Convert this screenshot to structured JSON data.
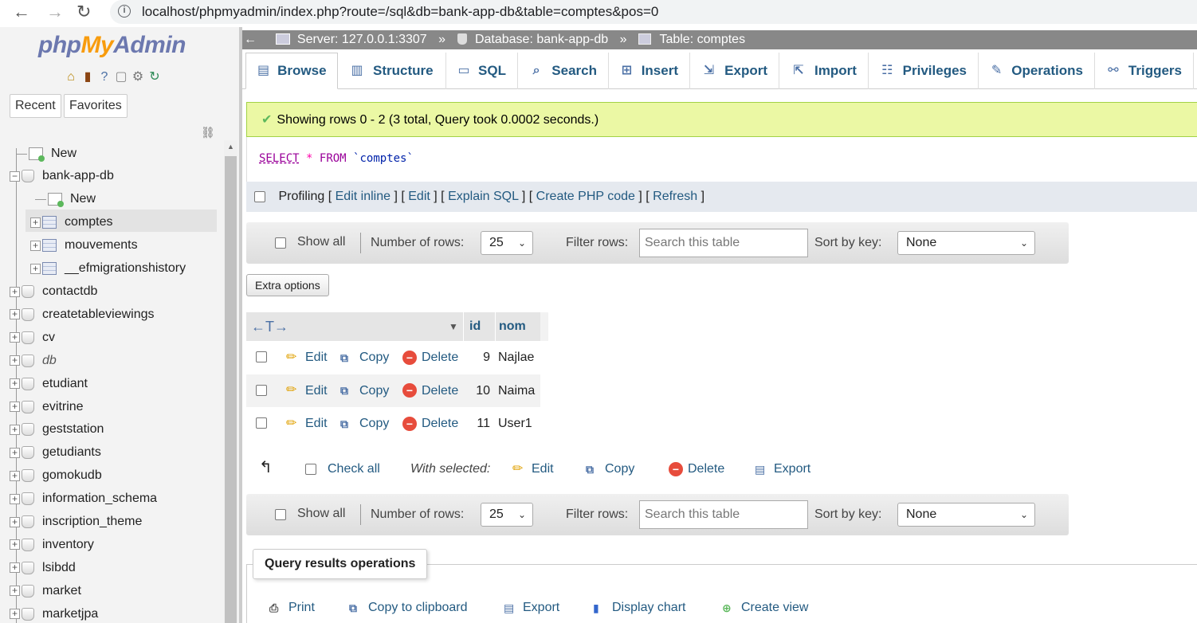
{
  "browser": {
    "url": "localhost/phpmyadmin/index.php?route=/sql&db=bank-app-db&table=comptes&pos=0",
    "info_icon": "i"
  },
  "nav": {
    "logo_php": "php",
    "logo_my": "My",
    "logo_admin": "Admin",
    "tabs": {
      "recent": "Recent",
      "favorites": "Favorites"
    },
    "tree": {
      "new": "New",
      "bank_db": "bank-app-db",
      "bank_new": "New",
      "comptes": "comptes",
      "mouvements": "mouvements",
      "migrations": "__efmigrationshistory",
      "others": [
        "contactdb",
        "createtableviewings",
        "cv",
        "db",
        "etudiant",
        "evitrine",
        "geststation",
        "getudiants",
        "gomokudb",
        "information_schema",
        "inscription_theme",
        "inventory",
        "lsibdd",
        "market",
        "marketjpa"
      ]
    }
  },
  "breadcrumb": {
    "back": "←",
    "server": "Server: 127.0.0.1:3307",
    "database": "Database: bank-app-db",
    "table": "Table: comptes",
    "separator": "»"
  },
  "tabs": {
    "browse": "Browse",
    "structure": "Structure",
    "sql": "SQL",
    "search": "Search",
    "insert": "Insert",
    "export": "Export",
    "import": "Import",
    "privileges": "Privileges",
    "operations": "Operations",
    "triggers": "Triggers"
  },
  "message": {
    "success": "Showing rows 0 - 2 (3 total, Query took 0.0002 seconds.)"
  },
  "sql": {
    "select": "SELECT",
    "star": "*",
    "from": "FROM",
    "table": "`comptes`"
  },
  "profiling": {
    "label": "Profiling",
    "open": "[",
    "close": "]",
    "sep": "] [",
    "edit_inline": "Edit inline",
    "edit": "Edit",
    "explain": "Explain SQL",
    "create_php": "Create PHP code",
    "refresh": "Refresh"
  },
  "navbar": {
    "show_all": "Show all",
    "num_rows_label": "Number of rows:",
    "num_rows_value": "25",
    "filter_label": "Filter rows:",
    "filter_placeholder": "Search this table",
    "sort_label": "Sort by key:",
    "sort_value": "None"
  },
  "extra_options": "Extra options",
  "results": {
    "arrows": "←T→",
    "sort_marker": "▼",
    "columns": [
      "id",
      "nom"
    ],
    "actions": {
      "edit": "Edit",
      "copy": "Copy",
      "delete": "Delete"
    },
    "rows": [
      {
        "id": "9",
        "nom": "Najlae"
      },
      {
        "id": "10",
        "nom": "Naima"
      },
      {
        "id": "11",
        "nom": "User1"
      }
    ]
  },
  "with_selected": {
    "check_all": "Check all",
    "label": "With selected:",
    "edit": "Edit",
    "copy": "Copy",
    "delete": "Delete",
    "export": "Export"
  },
  "query_ops": {
    "title": "Query results operations",
    "print": "Print",
    "copy_clipboard": "Copy to clipboard",
    "export": "Export",
    "display_chart": "Display chart",
    "create_view": "Create view"
  },
  "colors": {
    "link": "#235a81",
    "success_bg": "#ebf8a4",
    "breadcrumb_bg": "#888888",
    "nav_bg": "#f3f3f3"
  }
}
